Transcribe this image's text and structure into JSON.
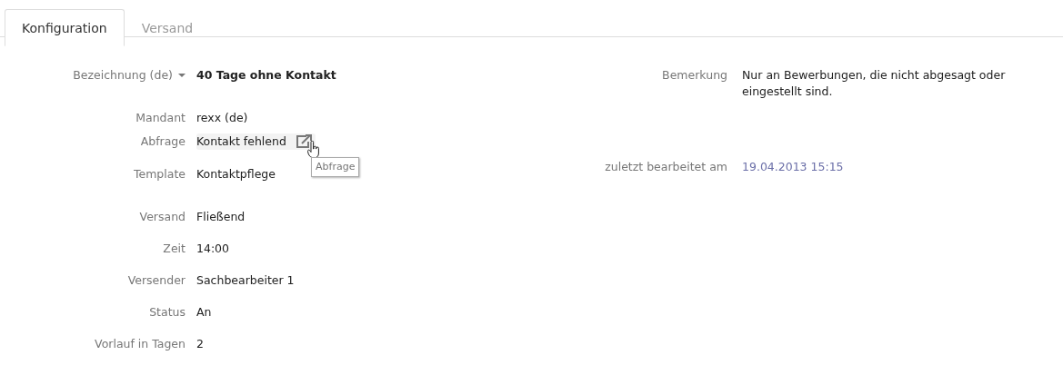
{
  "tabs": [
    {
      "label": "Konfiguration",
      "selected": true
    },
    {
      "label": "Versand",
      "selected": false
    }
  ],
  "left_fields": [
    {
      "label": "Bezeichnung (de)",
      "value": "40 Tage ohne Kontakt",
      "kind": "title"
    },
    {
      "label": "Mandant",
      "value": "rexx (de)",
      "kind": "text"
    },
    {
      "label": "Abfrage",
      "value": "Kontakt fehlend",
      "kind": "link",
      "tooltip": "Abfrage"
    },
    {
      "label": "Template",
      "value": "Kontaktpflege",
      "kind": "text"
    },
    {
      "label": "Versand",
      "value": "Fließend",
      "kind": "text"
    },
    {
      "label": "Zeit",
      "value": "14:00",
      "kind": "text"
    },
    {
      "label": "Versender",
      "value": "Sachbearbeiter 1",
      "kind": "text"
    },
    {
      "label": "Status",
      "value": "An",
      "kind": "text"
    },
    {
      "label": "Vorlauf in Tagen",
      "value": "2",
      "kind": "text"
    }
  ],
  "right_fields": [
    {
      "label": "Bemerkung",
      "value": "Nur an Bewerbungen, die nicht abgesagt oder eingestellt sind.",
      "kind": "text"
    },
    {
      "label": "zuletzt bearbeitet am",
      "value": "19.04.2013 15:15",
      "kind": "date"
    }
  ]
}
